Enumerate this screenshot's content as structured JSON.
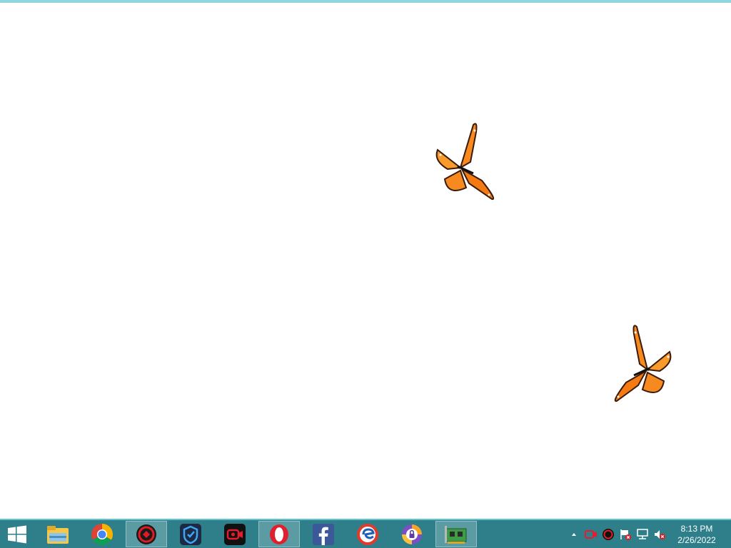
{
  "desktop": {
    "background_color": "#ffffff",
    "decorations": [
      {
        "name": "butterfly-icon"
      },
      {
        "name": "butterfly-icon"
      }
    ]
  },
  "taskbar": {
    "color": "#2e7f8a",
    "start": {
      "icon": "windows-logo-icon"
    },
    "pinned": [
      {
        "name": "file-explorer",
        "icon": "folder-icon",
        "active": false
      },
      {
        "name": "google-chrome",
        "icon": "chrome-icon",
        "active": false
      },
      {
        "name": "security-app",
        "icon": "shield-red-icon",
        "active": true
      },
      {
        "name": "vpn-app",
        "icon": "vpn-shield-icon",
        "active": false
      },
      {
        "name": "screen-recorder",
        "icon": "video-camera-icon",
        "active": false
      },
      {
        "name": "opera",
        "icon": "opera-icon",
        "active": true
      },
      {
        "name": "facebook",
        "icon": "facebook-icon",
        "active": false
      },
      {
        "name": "uc-browser",
        "icon": "browser-icon",
        "active": false
      },
      {
        "name": "privacy-app",
        "icon": "lock-icon",
        "active": false
      },
      {
        "name": "network-card",
        "icon": "network-card-icon",
        "active": true
      }
    ],
    "tray": {
      "icons": [
        "chevron-up-icon",
        "video-camera-icon",
        "security-tray-icon",
        "flag-icon",
        "network-icon",
        "volume-muted-icon"
      ],
      "time": "8:13 PM",
      "date": "2/26/2022"
    }
  }
}
